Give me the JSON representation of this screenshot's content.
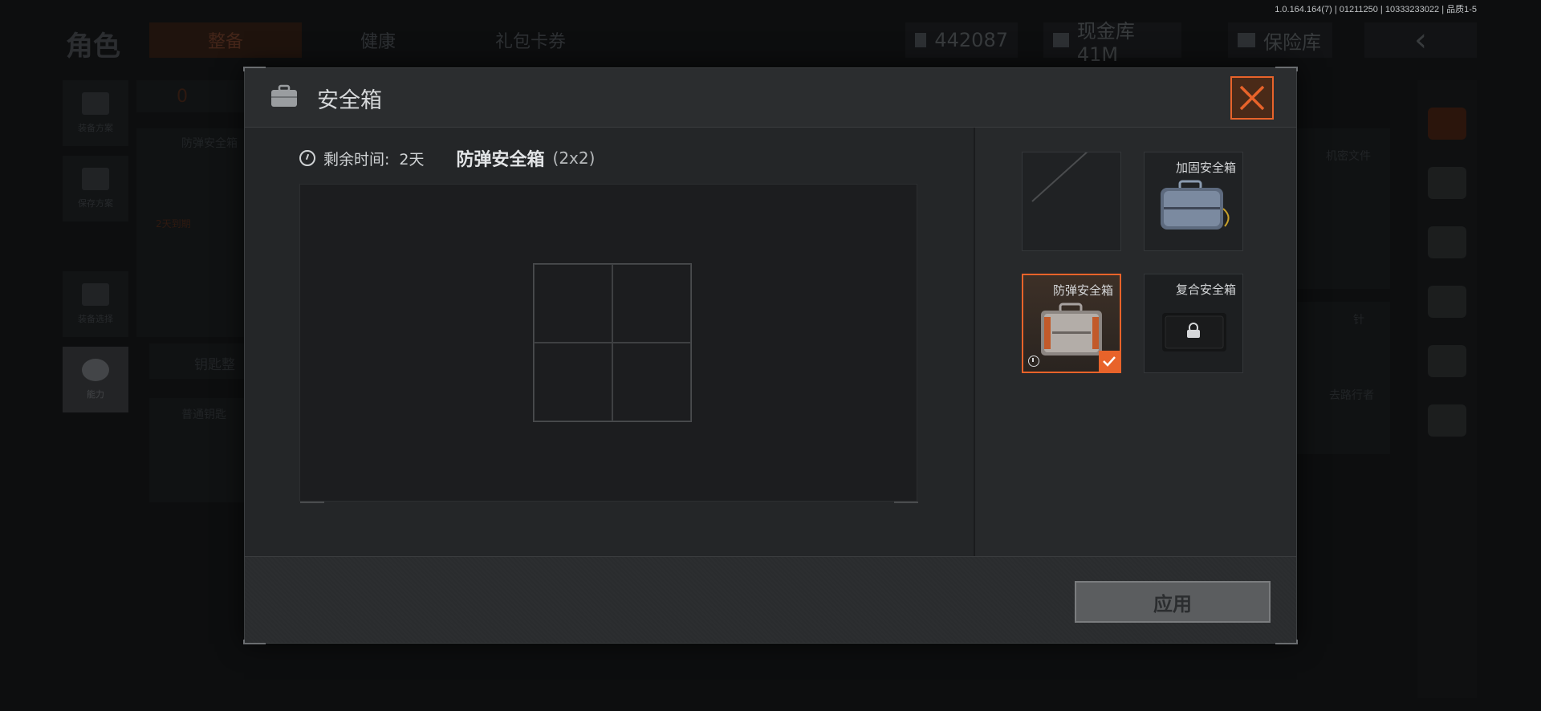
{
  "version_info": "1.0.164.164(7) | 01211250 | 10333233022 | 品质1-5",
  "background": {
    "title": "角色",
    "tabs": [
      {
        "label": "整备",
        "active": true
      },
      {
        "label": "健康",
        "active": false
      },
      {
        "label": "礼包卡券",
        "active": false
      }
    ],
    "currencies": [
      {
        "icon": "coin-stack-icon",
        "value": "442087"
      },
      {
        "icon": "cash-vault-icon",
        "value": "现金库 41M"
      },
      {
        "icon": "safe-vault-icon",
        "value": "保险库"
      }
    ],
    "back_icon": "chevron-left-icon",
    "left_menu": [
      {
        "icon": "vest-icon",
        "label": "装备方案"
      },
      {
        "icon": "download-icon",
        "label": "保存方案"
      },
      {
        "icon": "helmet-icon",
        "label": "装备选择"
      },
      {
        "icon": "lightning-hex-icon",
        "label": "能力"
      }
    ],
    "panel_texts": {
      "armor_count": "0",
      "safe_case_title": "防弹安全箱",
      "safe_case_timer": "2天到期",
      "keys_label": "钥匙整",
      "normal_key_label": "普通钥匙",
      "doc_label": "机密文件",
      "needle_label": "针",
      "tour_label": "去路行者"
    }
  },
  "modal": {
    "title": "安全箱",
    "title_icon": "briefcase-icon",
    "close_icon": "close-icon",
    "remaining_time_label": "剩余时间:",
    "remaining_time_value": "2天",
    "case_name": "防弹安全箱",
    "case_size": "(2x2)",
    "grid": {
      "columns": 2,
      "rows": 2
    },
    "cases": [
      {
        "label": "",
        "state": "empty",
        "selected": false
      },
      {
        "label": "加固安全箱",
        "state": "available",
        "selected": false
      },
      {
        "label": "防弹安全箱",
        "state": "timed",
        "selected": true
      },
      {
        "label": "复合安全箱",
        "state": "locked",
        "selected": false
      }
    ],
    "apply_label": "应用"
  },
  "colors": {
    "accent": "#e8632a",
    "modal_bg": "#26282a",
    "disabled_button": "#5b5d5f"
  }
}
